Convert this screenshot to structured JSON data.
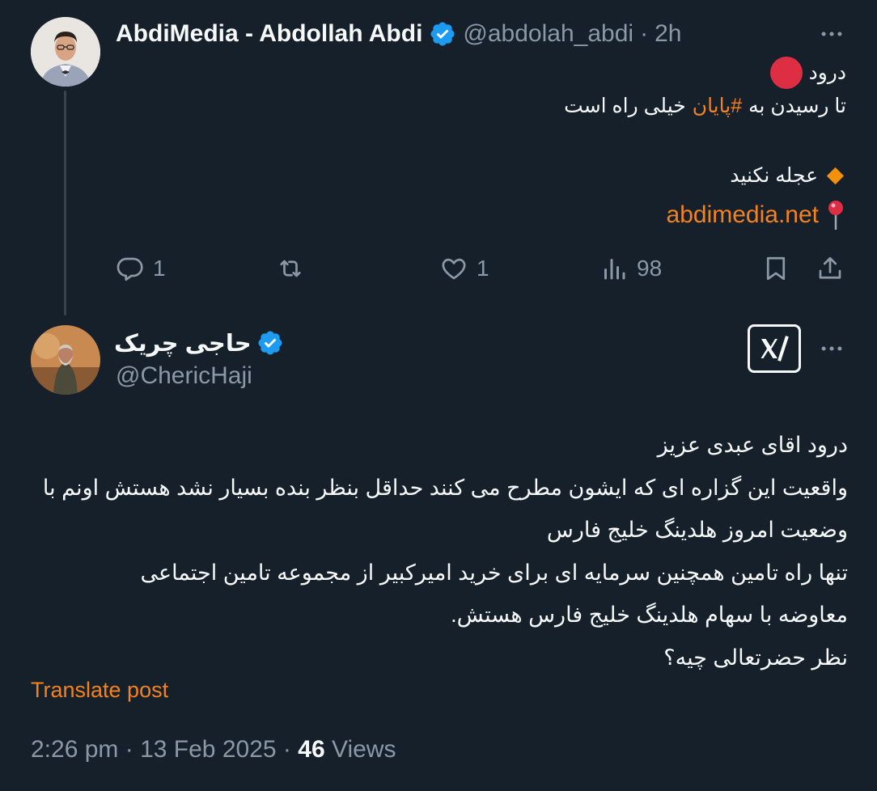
{
  "post1": {
    "author_name": "AbdiMedia - Abdollah Abdi",
    "handle": "@abdolah_abdi",
    "separator": "·",
    "time": "2h",
    "line1_text": "درود",
    "line2_before": "تا رسیدن به ",
    "line2_hashtag": "#پایان",
    "line2_after": " خیلی راه است",
    "line3_text": "عجله نکنید",
    "link_text": "abdimedia.net",
    "stats": {
      "replies": "1",
      "reposts": "",
      "likes": "1",
      "views": "98"
    }
  },
  "post2": {
    "author_name": "حاجی چریک",
    "handle": "@ChericHaji",
    "body_lines": [
      "درود اقای عبدی عزیز",
      "واقعیت این گزاره ای که ایشون مطرح می کنند حداقل بنظر بنده بسیار نشد هستش اونم با",
      "وضعیت امروز  هلدینگ خلیج فارس",
      "تنها راه تامین همچنین سرمایه ای برای خرید امیرکبیر از مجموعه تامین اجتماعی",
      "معاوضه با سهام هلدینگ خلیج فارس هستش.",
      "نظر حضرتعالی چیه؟"
    ],
    "translate_label": "Translate post",
    "timestamp": "2:26 pm",
    "dot1": "·",
    "date": "13 Feb 2025",
    "dot2": "·",
    "views_count": "46",
    "views_label": "Views"
  },
  "icons": {
    "verified": "verified-badge-icon",
    "more": "more-dots-icon",
    "reply": "reply-icon",
    "repost": "repost-icon",
    "like": "heart-icon",
    "views": "views-chart-icon",
    "bookmark": "bookmark-icon",
    "share": "share-icon",
    "grok": "grok-icon",
    "red_circle": "red-circle-emoji",
    "diamond": "orange-diamond-emoji",
    "pin": "round-pushpin-emoji"
  },
  "colors": {
    "background": "#15202b",
    "text": "#f7f9f9",
    "secondary_text": "#8b98a5",
    "accent": "#f4821f",
    "verified": "#1d9bf0"
  }
}
